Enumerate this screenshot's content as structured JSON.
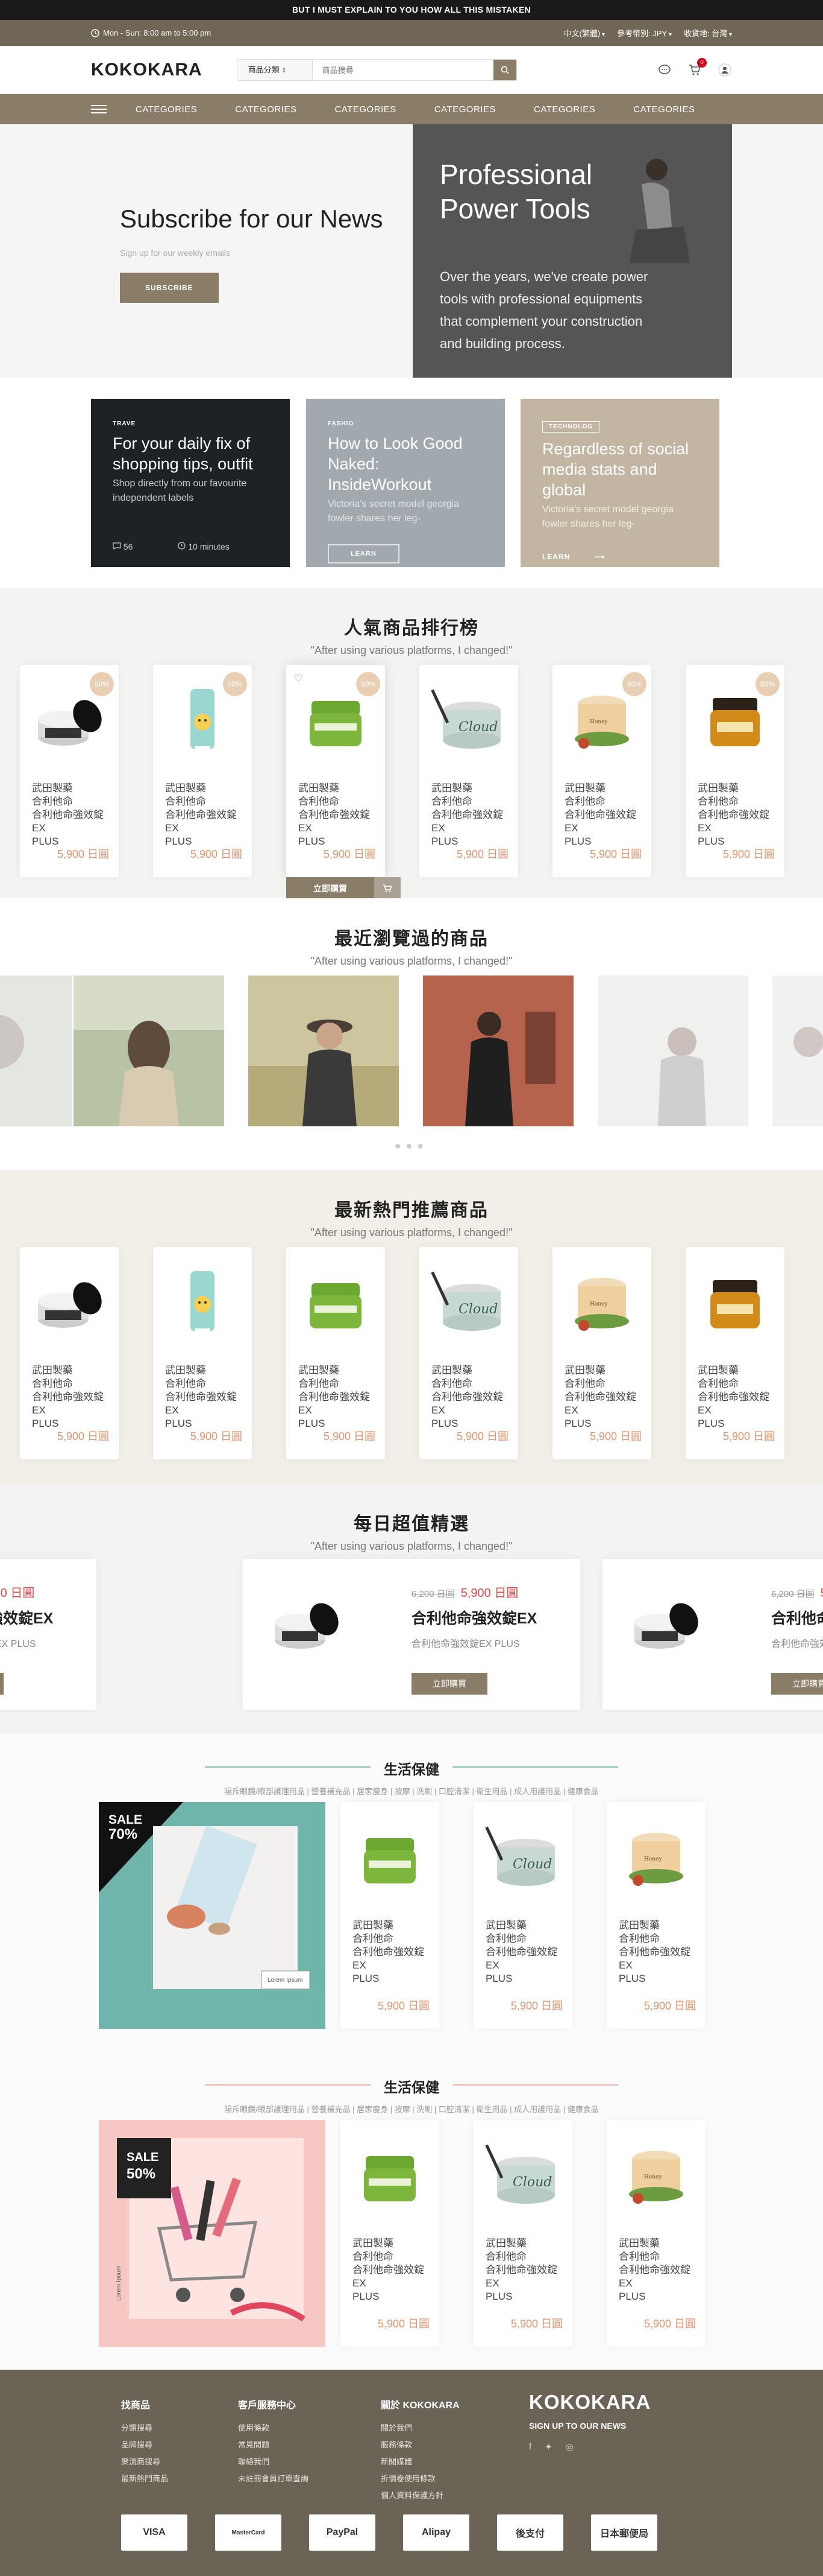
{
  "topbar": {
    "text": "BUT I MUST EXPLAIN TO YOU HOW ALL THIS MISTAKEN"
  },
  "metabar": {
    "hours": "Mon - Sun: 8:00 am to 5:00 pm",
    "language": "中文(繁體)",
    "currency": "參考幣別: JPY",
    "region": "收貨地: 台灣"
  },
  "header": {
    "logo": "KOKOKARA",
    "search_category": "商品分類",
    "search_placeholder": "商品搜尋",
    "cart_count": "0"
  },
  "nav": {
    "items": [
      "CATEGORIES",
      "CATEGORIES",
      "CATEGORIES",
      "CATEGORIES",
      "CATEGORIES",
      "CATEGORIES"
    ]
  },
  "hero": {
    "title": "Subscribe for our News",
    "subtitle": "Sign up for our weekly emails",
    "button": "SUBSCRIBE",
    "promo_title": "Professional Power Tools",
    "promo_text": "Over the years, we've create power tools with professional equipments that complement your construction and building process."
  },
  "blogs": [
    {
      "tag": "TRAVE",
      "title": "For your daily fix of shopping tips, outfit",
      "sub": "Shop directly from our favourite independent labels",
      "comments": "56",
      "time": "10 minutes"
    },
    {
      "tag": "FASHIO",
      "title": "How to Look Good Naked: InsideWorkout",
      "sub": "Victoria's secret model georgia fowler shares her leg-",
      "button": "LEARN"
    },
    {
      "tag": "TECHNOLOG",
      "title": "Regardless of social media stats and global",
      "sub": "Victoria's secret model georgia fowler shares her leg-",
      "button": "LEARN"
    }
  ],
  "sections": {
    "rank_title": "人氣商品排行榜",
    "rank_sub": "\"After using various platforms, I changed!\"",
    "recent_title": "最近瀏覽過的商品",
    "recent_sub": "\"After using various platforms, I changed!\"",
    "hot_title": "最新熱門推薦商品",
    "hot_sub": "\"After using various platforms, I changed!\"",
    "daily_title": "每日超值精選",
    "daily_sub": "\"After using various platforms, I changed!\""
  },
  "product": {
    "brand": "武田製藥",
    "line1": "合利他命",
    "line2": "合利他命強效錠EX",
    "line3": "PLUS",
    "price": "5,900 日圓",
    "sale": "50%",
    "buy": "立即購買"
  },
  "deals": {
    "old_price": "6,200 日圓",
    "new_price": "5,900 日圓",
    "name": "合利他命強效錠EX",
    "sub": "合利他命強效錠EX PLUS",
    "button": "立即購買"
  },
  "categories": [
    {
      "title": "生活保健",
      "sub": "陽斥眼鏡/眼部護理用品 | 營養補充品 | 居家瘦身 | 按摩 | 洗刷 | 口腔清潔 | 衛生用品 | 成人用護用品 | 健康食品",
      "banner_sale": "SALE",
      "banner_pct": "70%",
      "banner_caption": "Lorem Ipsum"
    },
    {
      "title": "生活保健",
      "sub": "陽斥眼鏡/眼部護理用品 | 營養補充品 | 居家瘦身 | 按摩 | 洗刷 | 口腔清潔 | 衛生用品 | 成人用護用品 | 健康食品",
      "banner_sale": "SALE",
      "banner_pct": "50%",
      "banner_caption": "Lorem Ipsum"
    }
  ],
  "footer": {
    "col1": {
      "title": "找商品",
      "items": [
        "分類搜尋",
        "品牌搜尋",
        "聚流商搜尋",
        "最新熱門商品"
      ]
    },
    "col2": {
      "title": "客戶服務中心",
      "items": [
        "使用條款",
        "常見問題",
        "聯絡我們",
        "未註冊會員訂單查詢"
      ]
    },
    "col3": {
      "title": "關於 KOKOKARA",
      "items": [
        "關於我們",
        "服務條款",
        "新聞媒體",
        "折價卷使用條款",
        "個人資料保護方針"
      ]
    },
    "brand": "KOKOKARA",
    "signup": "SIGN UP TO OUR NEWS",
    "payments": [
      "VISA",
      "MasterCard",
      "PayPal",
      "Alipay",
      "後支付",
      "日本郵便局"
    ]
  },
  "colors": {
    "accent": "#8a7d67",
    "metabar": "#706656",
    "footer": "#6a6356",
    "price": "#e0956e"
  }
}
